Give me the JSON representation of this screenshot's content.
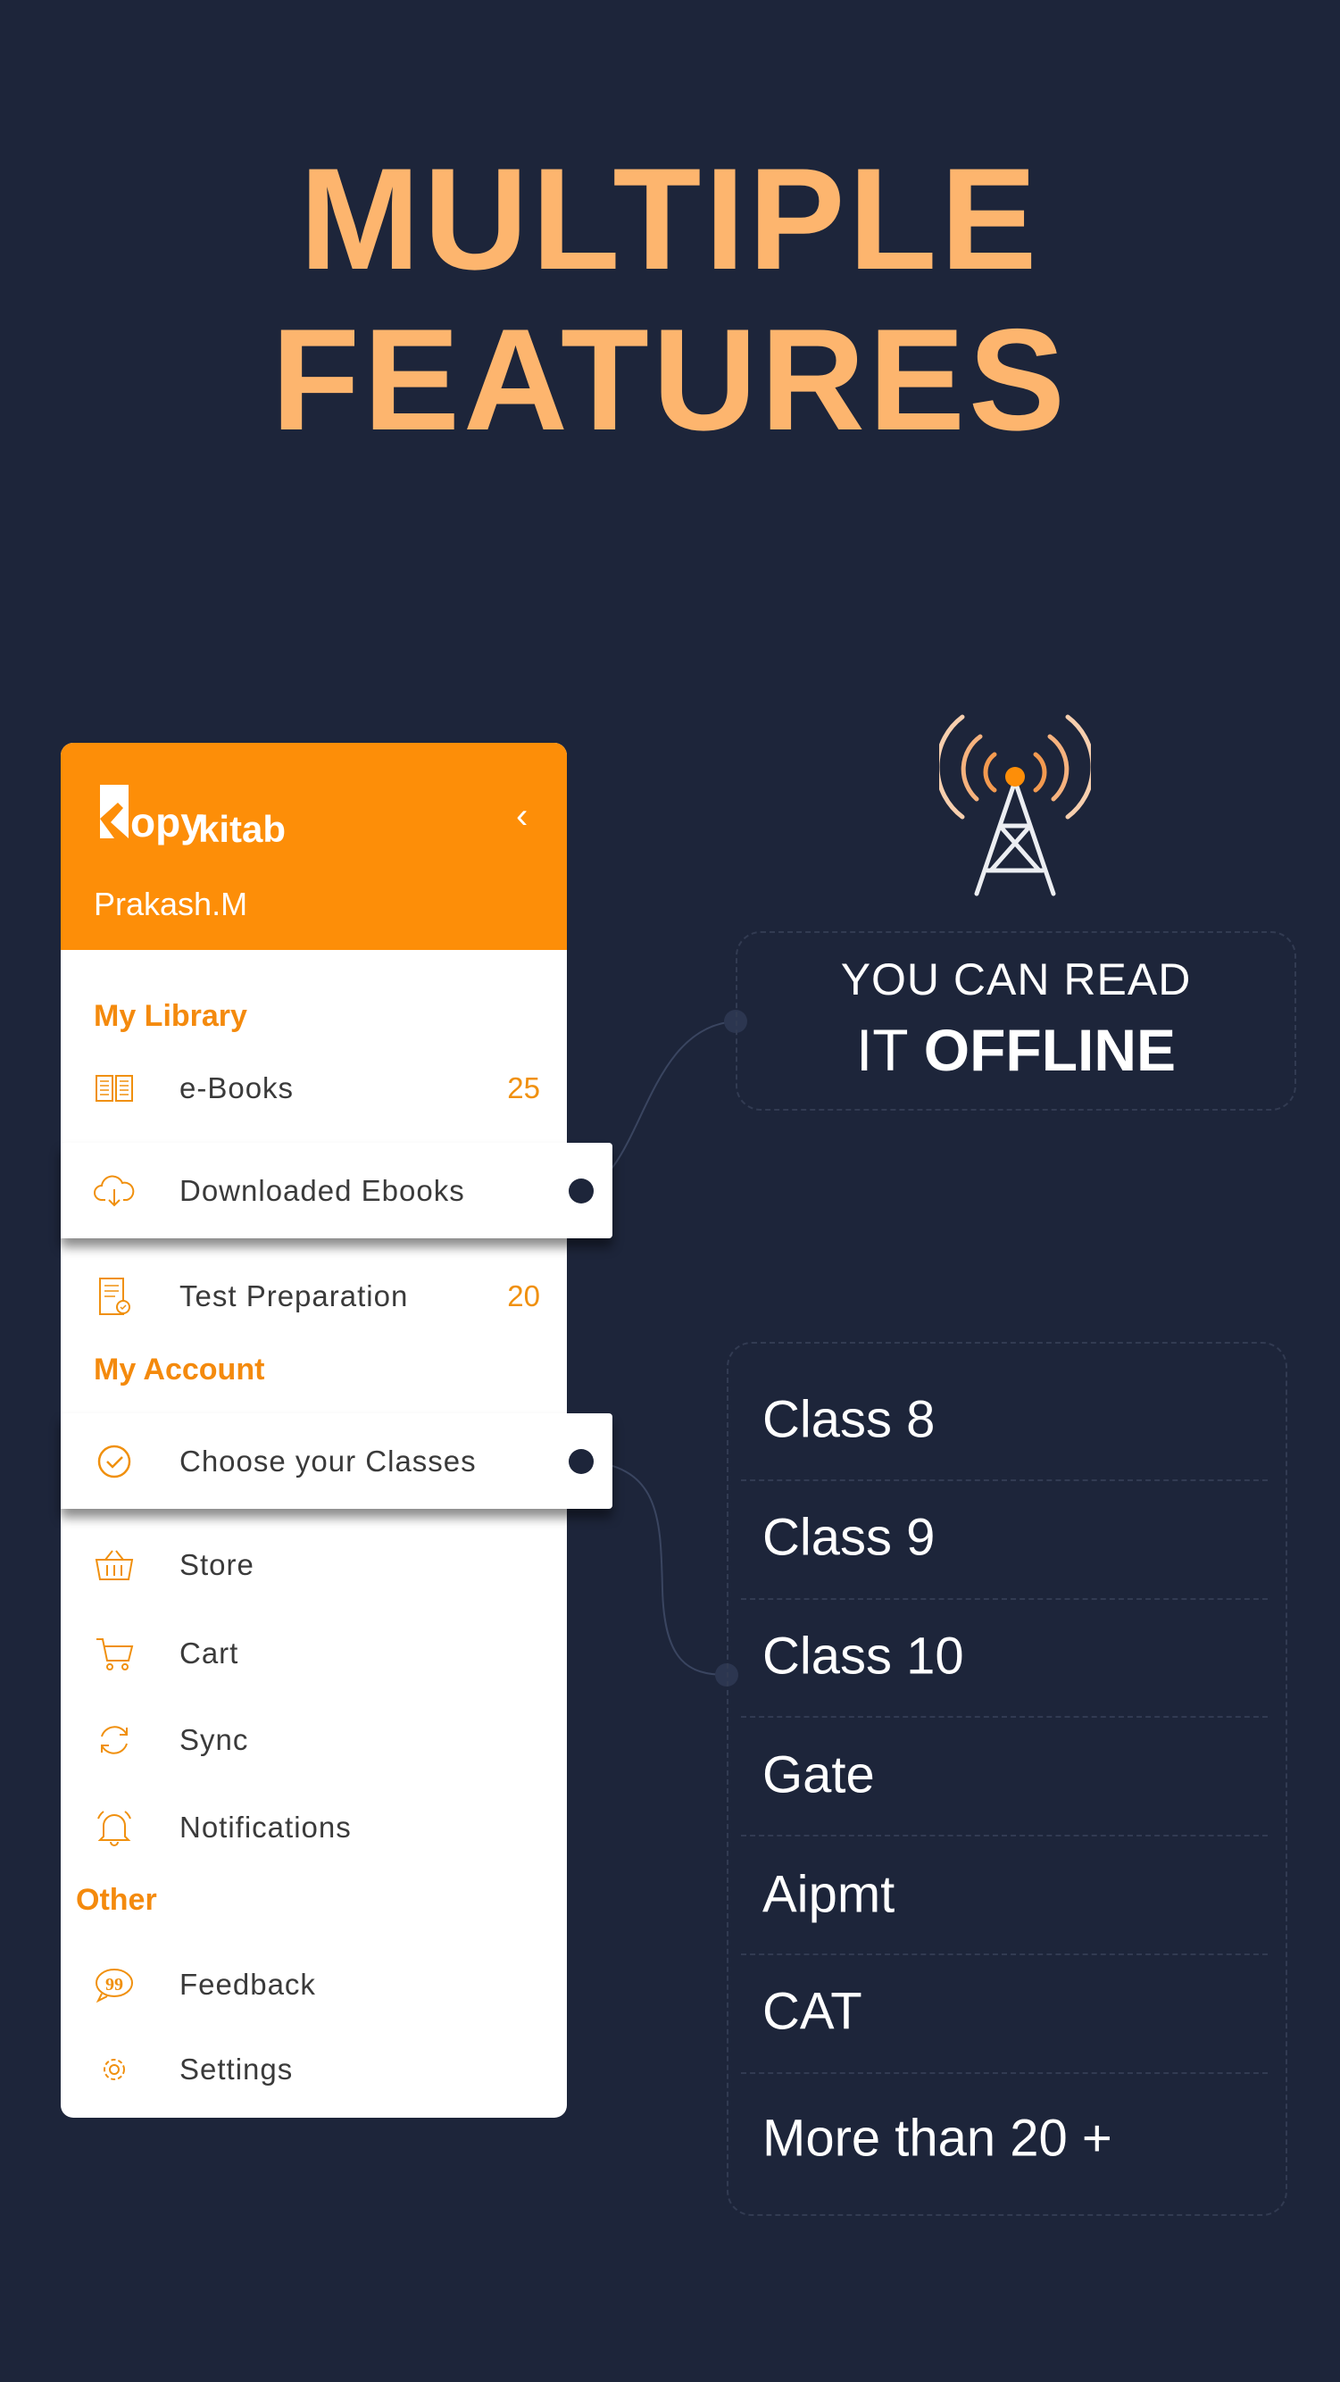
{
  "headline": {
    "line1": "MULTIPLE",
    "line2": "FEATURES"
  },
  "colors": {
    "background": "#1d253a",
    "accent": "#fd8e08",
    "headline": "#fdb56e"
  },
  "drawer": {
    "logo": "Kopykitab",
    "user_name": "Prakash.M",
    "collapse_icon": "chevron-left-icon",
    "sections": {
      "library": "My Library",
      "account": "My Account",
      "other": "Other"
    },
    "items": [
      {
        "label": "e-Books",
        "count": "25",
        "icon": "open-book-icon"
      },
      {
        "label": "Downloaded Ebooks",
        "icon": "cloud-download-icon"
      },
      {
        "label": "Test Preparation",
        "count": "20",
        "icon": "test-document-icon"
      },
      {
        "label": "Choose your Classes",
        "icon": "check-circle-icon"
      },
      {
        "label": "Store",
        "icon": "basket-icon"
      },
      {
        "label": "Cart",
        "icon": "cart-icon"
      },
      {
        "label": "Sync",
        "icon": "sync-icon"
      },
      {
        "label": "Notifications",
        "icon": "bell-icon"
      },
      {
        "label": "Feedback",
        "icon": "feedback-quote-icon"
      },
      {
        "label": "Settings",
        "icon": "gear-icon"
      }
    ]
  },
  "offline": {
    "line1": "YOU CAN READ",
    "line2_light": "IT",
    "line2_bold": "OFFLINE",
    "icon": "signal-tower-icon"
  },
  "classes": [
    "Class 8",
    "Class 9",
    "Class 10",
    "Gate",
    "Aipmt",
    "CAT",
    "More than 20 +"
  ]
}
